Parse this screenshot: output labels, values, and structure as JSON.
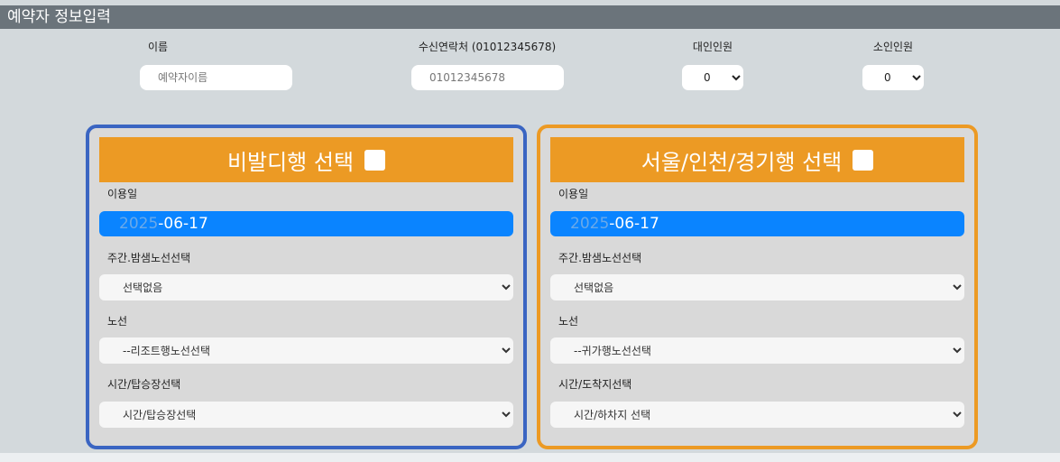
{
  "header": {
    "title": "예약자 정보입력"
  },
  "form": {
    "name_label": "이름",
    "name_placeholder": "예약자이름",
    "phone_label": "수신연락처 (01012345678)",
    "phone_placeholder": "01012345678",
    "adults_label": "대인인원",
    "adults_value": "0",
    "children_label": "소인인원",
    "children_value": "0"
  },
  "panel_left": {
    "title": "비발디행 선택",
    "date_label": "이용일",
    "date_year": "2025",
    "date_rest": "-06-17",
    "route_type_label": "주간.밤샘노선선택",
    "route_type_value": "선택없음",
    "route_label": "노선",
    "route_value": "--리조트행노선선택",
    "time_label": "시간/탑승장선택",
    "time_value": "시간/탑승장선택"
  },
  "panel_right": {
    "title": "서울/인천/경기행 선택",
    "date_label": "이용일",
    "date_year": "2025",
    "date_rest": "-06-17",
    "route_type_label": "주간.밤샘노선선택",
    "route_type_value": "선택없음",
    "route_label": "노선",
    "route_value": "--귀가행노선선택",
    "time_label": "시간/도착지선택",
    "time_value": "시간/하차지 선택"
  },
  "colors": {
    "accent_orange": "#ec9a24",
    "accent_blue": "#3a65c2",
    "date_blue": "#0a84ff"
  }
}
